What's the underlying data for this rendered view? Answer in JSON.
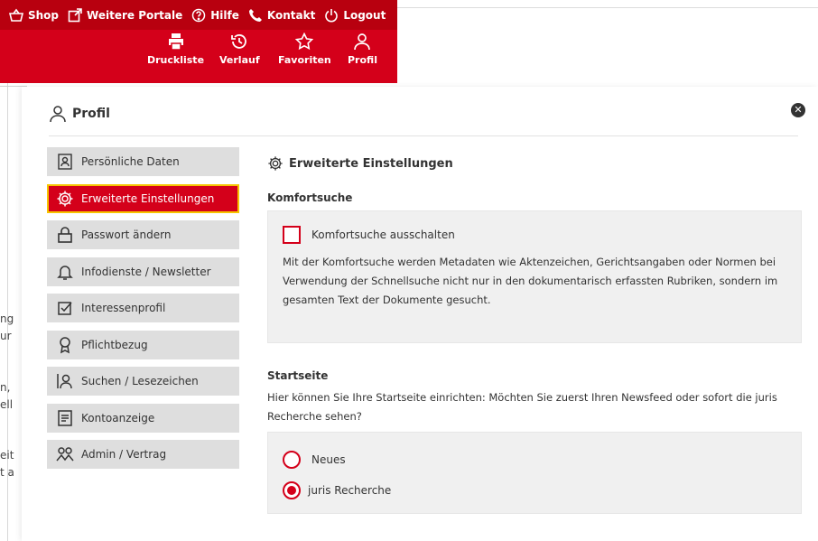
{
  "topnav": [
    {
      "label": "Shop",
      "icon": "basket-icon"
    },
    {
      "label": "Weitere Portale",
      "icon": "external-link-icon"
    },
    {
      "label": "Hilfe",
      "icon": "help-icon"
    },
    {
      "label": "Kontakt",
      "icon": "phone-icon"
    },
    {
      "label": "Logout",
      "icon": "power-icon"
    }
  ],
  "quicknav": [
    {
      "label": "Druckliste",
      "icon": "printer-icon"
    },
    {
      "label": "Verlauf",
      "icon": "history-icon"
    },
    {
      "label": "Favoriten",
      "icon": "star-icon"
    },
    {
      "label": "Profil",
      "icon": "user-icon"
    }
  ],
  "background_fragments": [
    "ng",
    "ur",
    "n,",
    "ell",
    "eit",
    "t a"
  ],
  "modal": {
    "title": "Profil",
    "close_symbol": "✕"
  },
  "menu": [
    {
      "label": "Persönliche Daten",
      "icon": "person-card-icon",
      "active": false
    },
    {
      "label": "Erweiterte Einstellungen",
      "icon": "gear-icon",
      "active": true
    },
    {
      "label": "Passwort ändern",
      "icon": "lock-icon",
      "active": false
    },
    {
      "label": "Infodienste / Newsletter",
      "icon": "bell-icon",
      "active": false
    },
    {
      "label": "Interessenprofil",
      "icon": "checkbox-edit-icon",
      "active": false
    },
    {
      "label": "Pflichtbezug",
      "icon": "award-icon",
      "active": false
    },
    {
      "label": "Suchen / Lesezeichen",
      "icon": "search-person-icon",
      "active": false
    },
    {
      "label": "Kontoanzeige",
      "icon": "document-icon",
      "active": false
    },
    {
      "label": "Admin / Vertrag",
      "icon": "users-icon",
      "active": false
    }
  ],
  "content": {
    "heading": "Erweiterte Einstellungen",
    "komfortsuche": {
      "title": "Komfortsuche",
      "checkbox_label": "Komfortsuche ausschalten",
      "checked": false,
      "description": "Mit der Komfortsuche werden Metadaten wie Aktenzeichen, Gerichtsangaben oder Normen bei Verwendung der Schnellsuche nicht nur in den dokumentarisch erfassten Rubriken, sondern im gesamten Text der Dokumente gesucht."
    },
    "startseite": {
      "title": "Startseite",
      "description": "Hier können Sie Ihre Startseite einrichten: Möchten Sie zuerst Ihren Newsfeed oder sofort die juris Recherche sehen?",
      "options": [
        {
          "label": "Neues",
          "selected": false
        },
        {
          "label": "juris Recherche",
          "selected": true
        }
      ]
    }
  },
  "colors": {
    "brand_red": "#d4001a",
    "dark_red": "#b8000f",
    "active_border": "#f6c400",
    "menu_gray": "#dedede",
    "box_gray": "#f0f0f0"
  }
}
